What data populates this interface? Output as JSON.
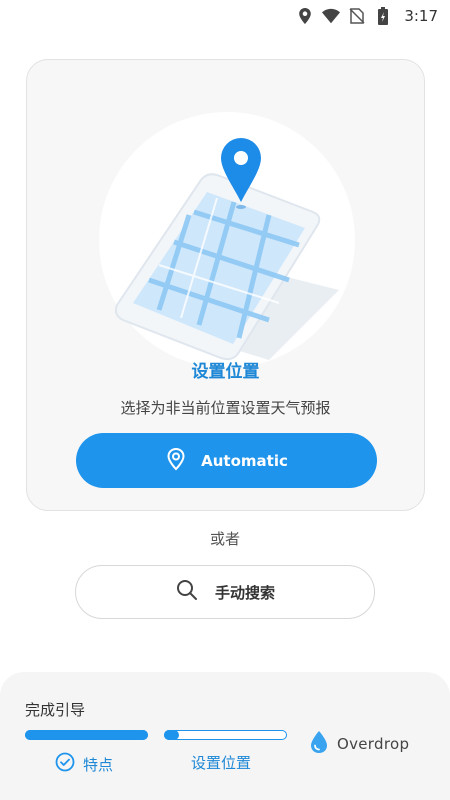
{
  "status_bar": {
    "time": "3:17",
    "icons": [
      "location-icon",
      "wifi-icon",
      "no-sim-icon",
      "battery-charging-icon"
    ]
  },
  "card": {
    "illustration": "phone-map-location-pin",
    "title": "设置位置",
    "subtitle": "选择为非当前位置设置天气预报",
    "automatic_button": {
      "label": "Automatic",
      "icon": "location-pin-icon"
    }
  },
  "or_label": "或者",
  "manual_search_button": {
    "label": "手动搜索",
    "icon": "search-icon"
  },
  "guide": {
    "title": "完成引导",
    "steps": [
      {
        "label": "特点",
        "progress": 1.0,
        "completed": true,
        "icon": "check-circle-icon"
      },
      {
        "label": "设置位置",
        "progress": 0.12,
        "completed": false
      }
    ],
    "brand": {
      "name": "Overdrop",
      "icon": "drop-logo-icon"
    }
  },
  "colors": {
    "accent": "#1f94ec",
    "title_blue": "#1e88d6",
    "card_bg": "#f7f7f7"
  }
}
